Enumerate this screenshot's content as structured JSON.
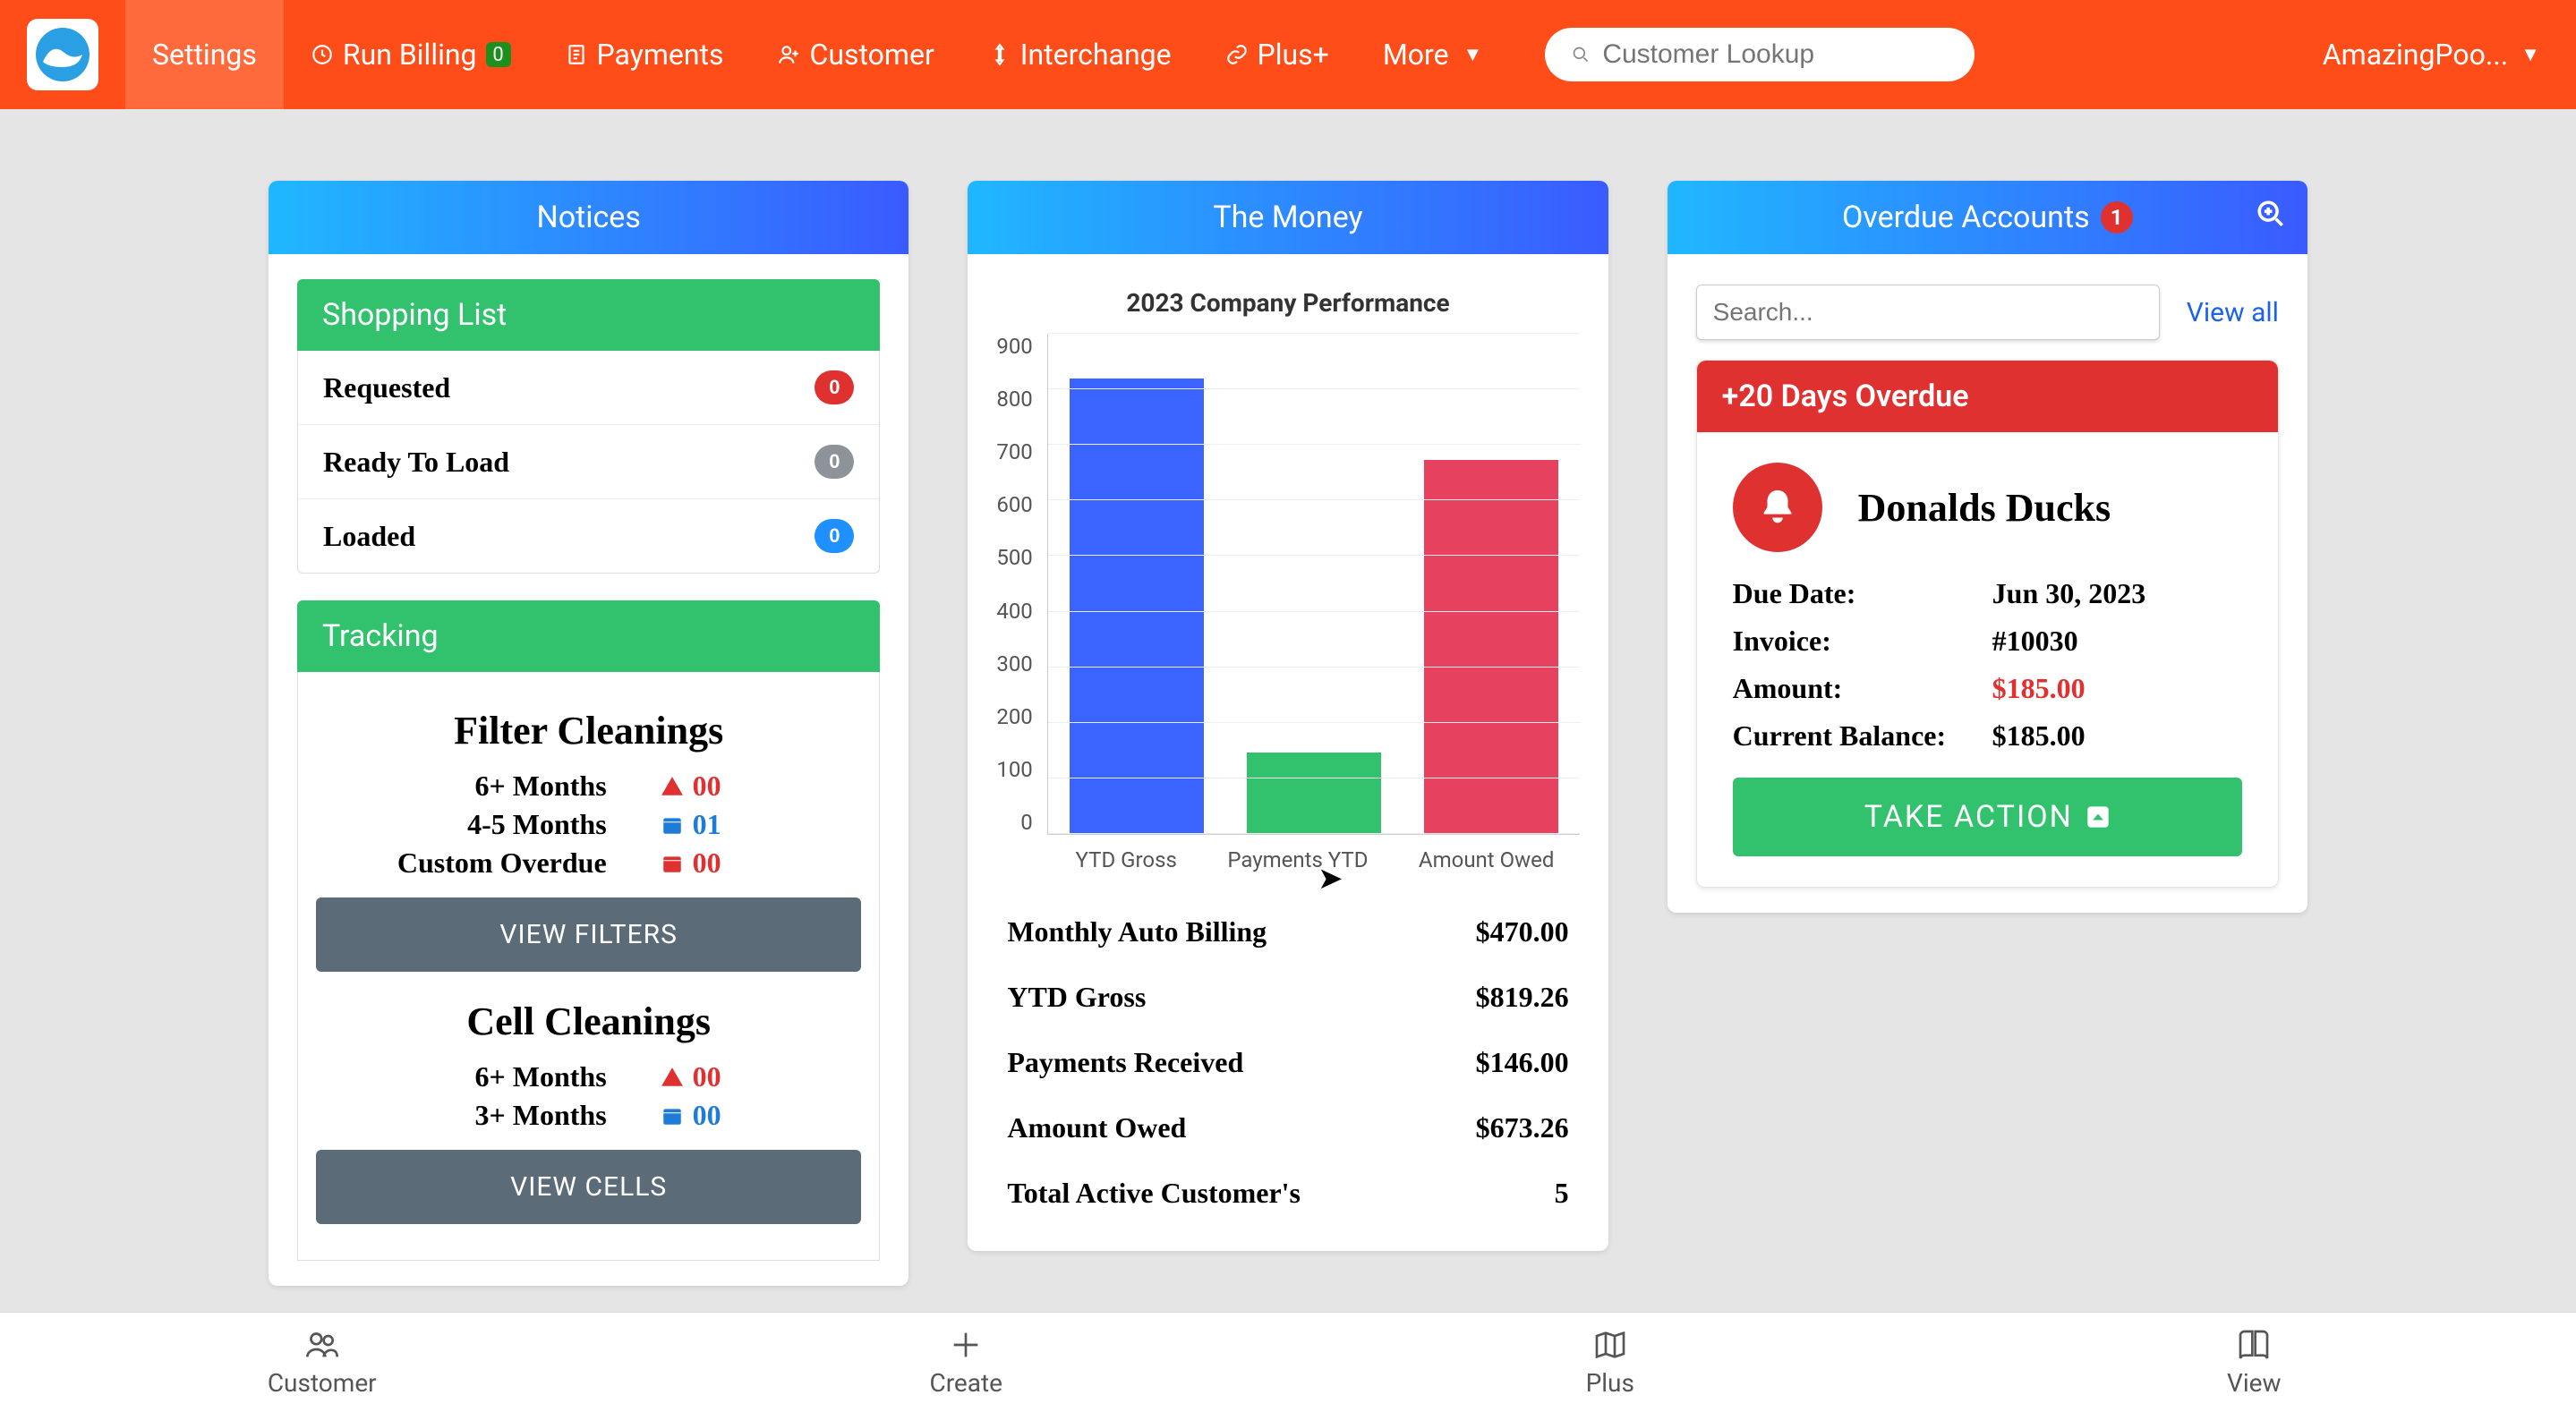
{
  "nav": {
    "settings": "Settings",
    "run_billing": "Run Billing",
    "run_billing_badge": "0",
    "payments": "Payments",
    "customer": "Customer",
    "interchange": "Interchange",
    "plus": "Plus+",
    "more": "More",
    "search_placeholder": "Customer Lookup",
    "account_name": "AmazingPoo..."
  },
  "notices": {
    "title": "Notices",
    "shopping_head": "Shopping List",
    "items": [
      {
        "label": "Requested",
        "count": "0",
        "color": "red"
      },
      {
        "label": "Ready To Load",
        "count": "0",
        "color": "grey"
      },
      {
        "label": "Loaded",
        "count": "0",
        "color": "blue"
      }
    ],
    "tracking_head": "Tracking",
    "filter_title": "Filter Cleanings",
    "filter_rows": [
      {
        "label": "6+ Months",
        "icon": "warn",
        "val": "00",
        "cls": "red"
      },
      {
        "label": "4-5 Months",
        "icon": "cal",
        "val": "01",
        "cls": "blue"
      },
      {
        "label": "Custom Overdue",
        "icon": "cal",
        "val": "00",
        "cls": "red"
      }
    ],
    "view_filters": "VIEW FILTERS",
    "cell_title": "Cell Cleanings",
    "cell_rows": [
      {
        "label": "6+ Months",
        "icon": "warn",
        "val": "00",
        "cls": "red"
      },
      {
        "label": "3+ Months",
        "icon": "cal",
        "val": "00",
        "cls": "blue"
      }
    ],
    "view_cells": "VIEW CELLS"
  },
  "money": {
    "title": "The Money",
    "chart_title": "2023 Company Performance",
    "rows": [
      {
        "k": "Monthly Auto Billing",
        "v": "$470.00"
      },
      {
        "k": "YTD Gross",
        "v": "$819.26"
      },
      {
        "k": "Payments Received",
        "v": "$146.00"
      },
      {
        "k": "Amount Owed",
        "v": "$673.26"
      },
      {
        "k": "Total Active Customer's",
        "v": "5"
      }
    ]
  },
  "chart_data": {
    "type": "bar",
    "title": "2023 Company Performance",
    "categories": [
      "YTD Gross",
      "Payments YTD",
      "Amount Owed"
    ],
    "values": [
      819.26,
      146.0,
      673.26
    ],
    "colors": [
      "#3a63ff",
      "#32c26d",
      "#e74160"
    ],
    "ylim": [
      0,
      900
    ],
    "yticks": [
      0,
      100,
      200,
      300,
      400,
      500,
      600,
      700,
      800,
      900
    ],
    "xlabel": "",
    "ylabel": ""
  },
  "overdue": {
    "title": "Overdue Accounts",
    "badge": "1",
    "search_placeholder": "Search...",
    "view_all": "View all",
    "banner": "+20 Days Overdue",
    "customer": "Donalds Ducks",
    "rows": [
      {
        "k": "Due Date:",
        "v": "Jun 30, 2023",
        "cls": ""
      },
      {
        "k": "Invoice:",
        "v": "#10030",
        "cls": ""
      },
      {
        "k": "Amount:",
        "v": "$185.00",
        "cls": "red"
      },
      {
        "k": "Current Balance:",
        "v": "$185.00",
        "cls": ""
      }
    ],
    "take_action": "TAKE ACTION"
  },
  "bottom": {
    "customer": "Customer",
    "create": "Create",
    "plus": "Plus",
    "view": "View"
  }
}
